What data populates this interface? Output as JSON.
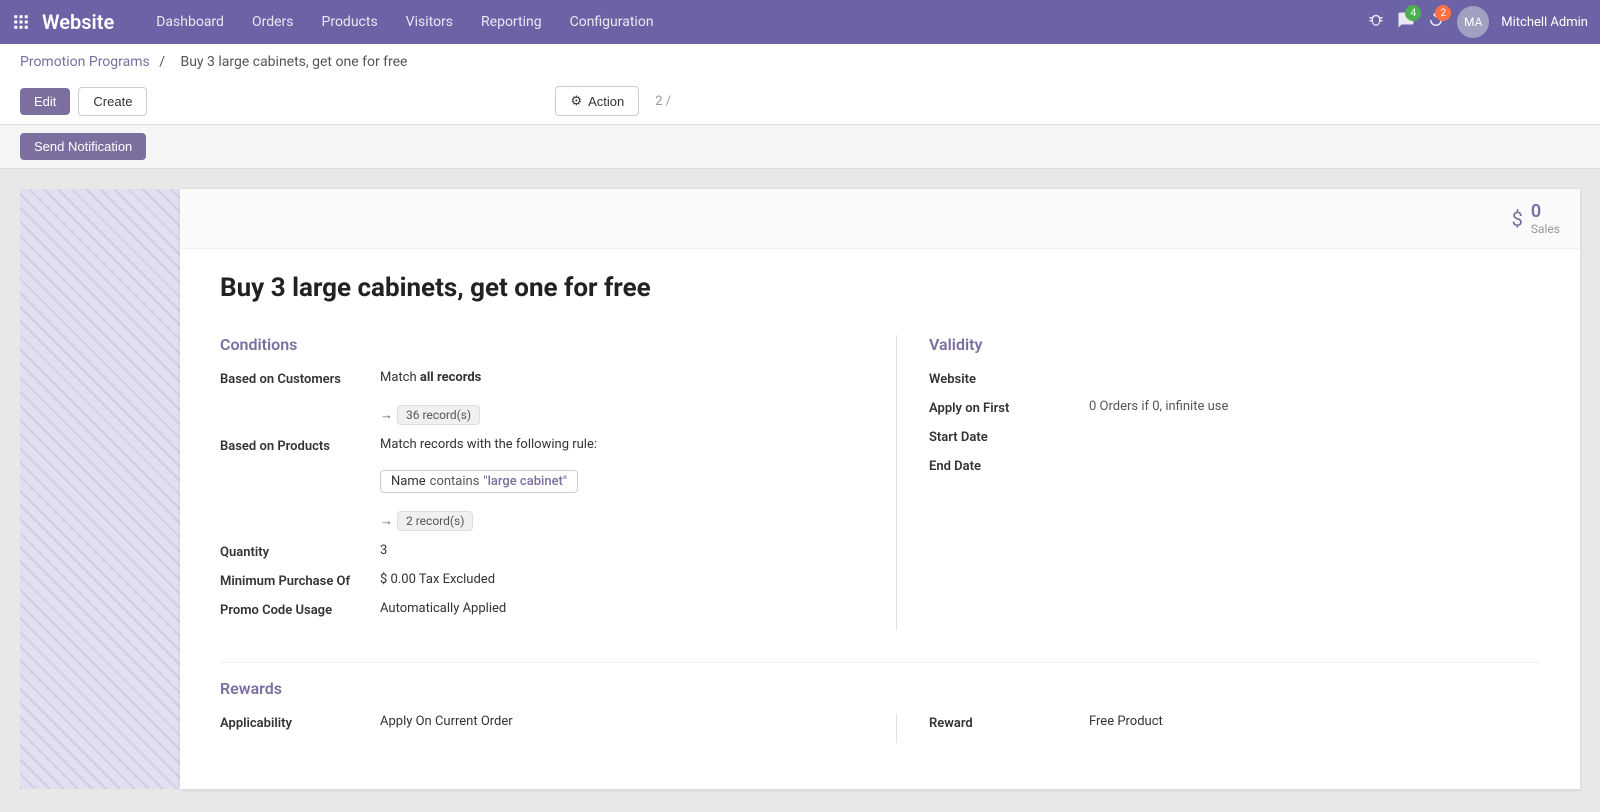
{
  "nav": {
    "logo": "Website",
    "items": [
      "Dashboard",
      "Orders",
      "Products",
      "Visitors",
      "Reporting",
      "Configuration"
    ],
    "user_name": "Mitchell Admin",
    "notification_count": "4",
    "update_count": "2"
  },
  "breadcrumb": {
    "parent": "Promotion Programs",
    "separator": "/",
    "current": "Buy 3 large cabinets, get one for free"
  },
  "toolbar": {
    "edit_label": "Edit",
    "create_label": "Create",
    "action_label": "Action",
    "page_info": "2 /",
    "send_notification_label": "Send Notification"
  },
  "stats": {
    "sales_count": "0",
    "sales_label": "Sales"
  },
  "record": {
    "title": "Buy 3 large cabinets, get one for free"
  },
  "conditions": {
    "section_title": "Conditions",
    "based_on_customers_label": "Based on Customers",
    "match_text": "Match",
    "all_records_text": "all records",
    "customers_record_count": "36 record(s)",
    "based_on_products_label": "Based on Products",
    "match_products_text": "Match records with the following rule:",
    "filter_key": "Name",
    "filter_op": "contains",
    "filter_val": "\"large cabinet\"",
    "products_record_count": "2 record(s)",
    "quantity_label": "Quantity",
    "quantity_value": "3",
    "min_purchase_label": "Minimum Purchase Of",
    "min_purchase_value": "$ 0.00 Tax Excluded",
    "promo_code_label": "Promo Code Usage",
    "promo_code_value": "Automatically Applied"
  },
  "validity": {
    "section_title": "Validity",
    "website_label": "Website",
    "website_value": "",
    "apply_on_first_label": "Apply on First",
    "apply_on_first_value": "",
    "orders_text": "0 Orders if 0, infinite use",
    "start_date_label": "Start Date",
    "start_date_value": "",
    "end_date_label": "End Date",
    "end_date_value": ""
  },
  "rewards": {
    "section_title": "Rewards",
    "applicability_label": "Applicability",
    "applicability_value": "Apply On Current Order",
    "reward_label": "Reward",
    "reward_value": "Free Product"
  }
}
